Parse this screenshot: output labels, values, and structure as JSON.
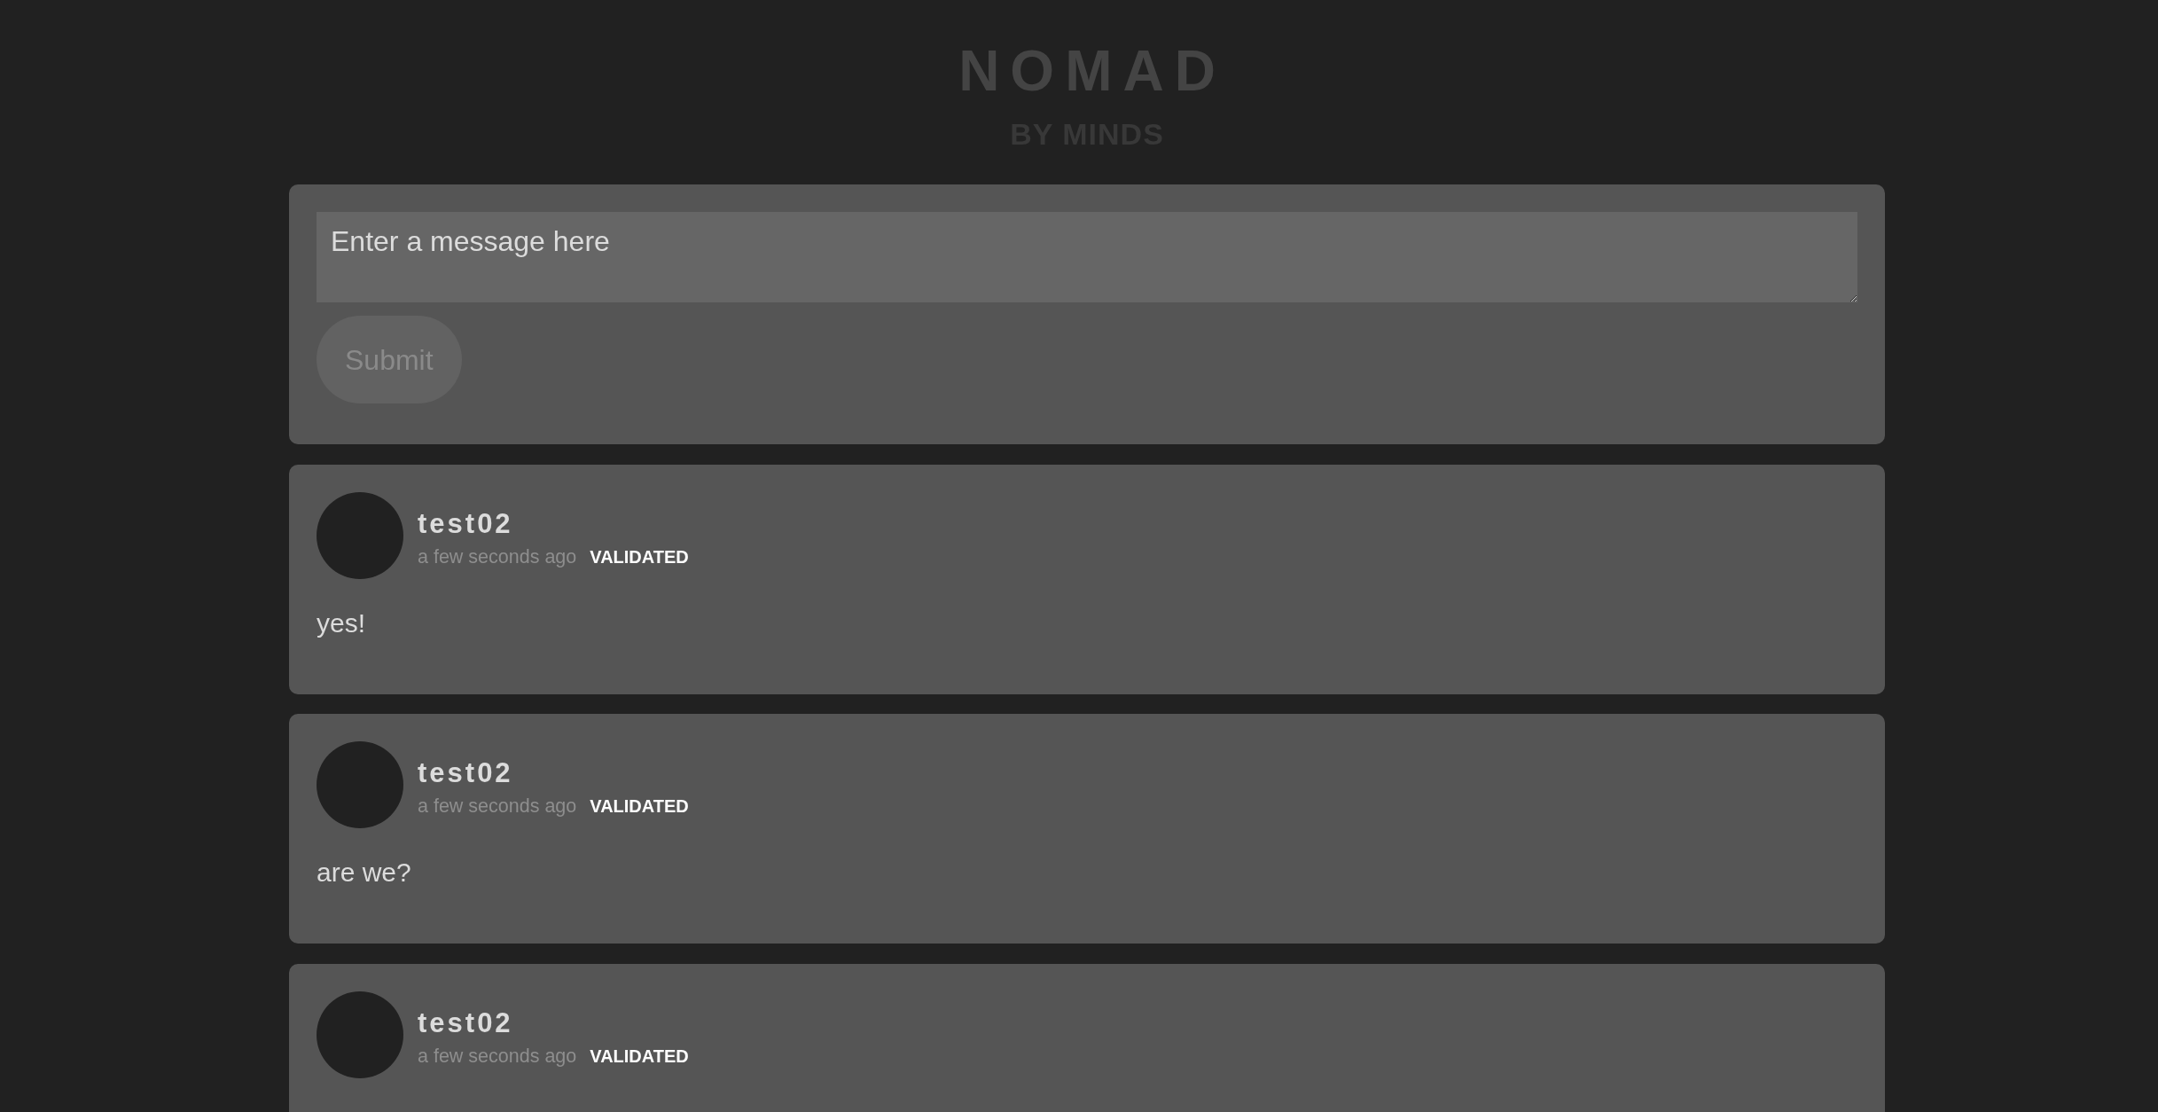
{
  "header": {
    "title": "NOMAD",
    "subtitle": "BY MINDS"
  },
  "composer": {
    "placeholder": "Enter a message here",
    "submit": {
      "label": "Submit",
      "disabled": true
    }
  },
  "posts": [
    {
      "author": "test02",
      "time": "a few seconds ago",
      "status": "VALIDATED",
      "message": "yes!"
    },
    {
      "author": "test02",
      "time": "a few seconds ago",
      "status": "VALIDATED",
      "message": "are we?"
    },
    {
      "author": "test02",
      "time": "a few seconds ago",
      "status": "VALIDATED"
    }
  ]
}
